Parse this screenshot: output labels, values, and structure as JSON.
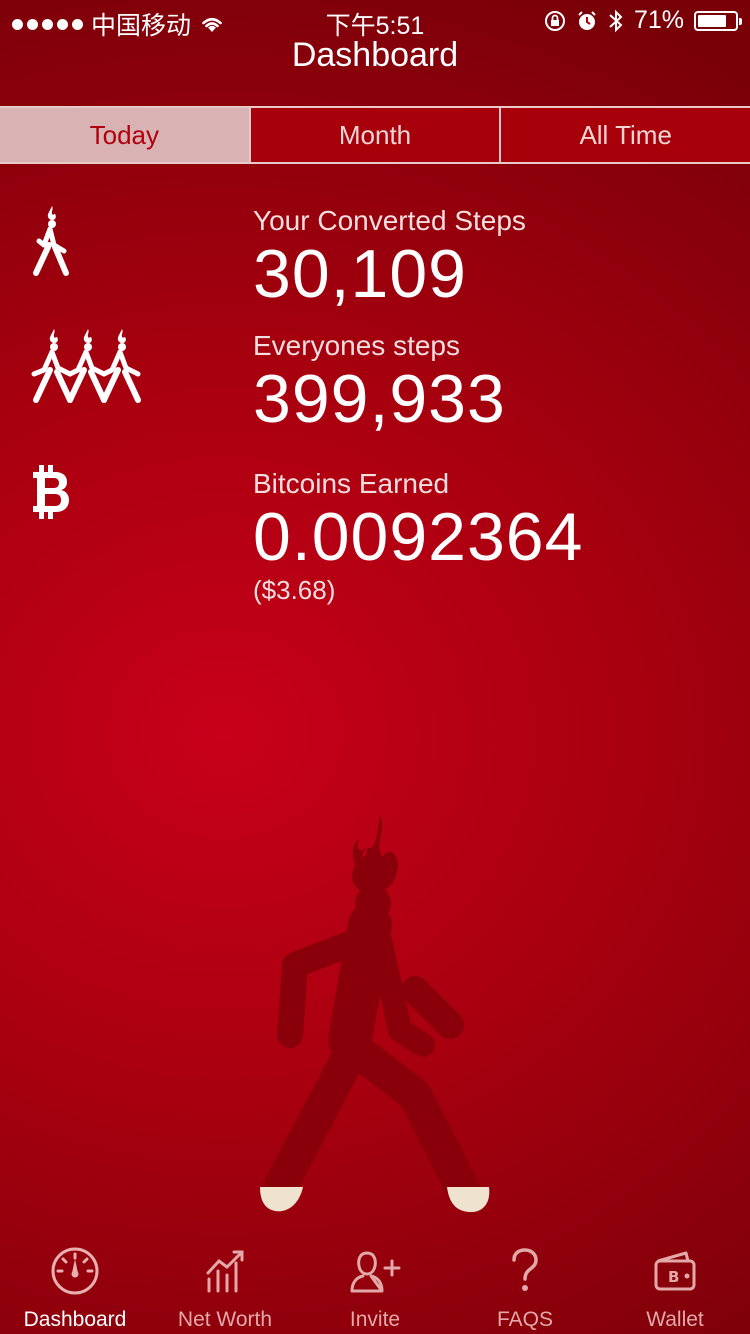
{
  "status_bar": {
    "carrier": "中国移动",
    "time": "下午5:51",
    "battery": "71%"
  },
  "header": {
    "title": "Dashboard"
  },
  "segments": [
    {
      "label": "Today",
      "active": true
    },
    {
      "label": "Month",
      "active": false
    },
    {
      "label": "All Time",
      "active": false
    }
  ],
  "stats": {
    "converted": {
      "label": "Your Converted Steps",
      "value": "30,109",
      "icon": "single-walker-icon"
    },
    "everyone": {
      "label": "Everyones steps",
      "value": "399,933",
      "icon": "group-walkers-icon"
    },
    "bitcoins": {
      "label": "Bitcoins Earned",
      "value": "0.0092364",
      "usd": "($3.68)",
      "icon": "bitcoin-icon"
    }
  },
  "tabbar": [
    {
      "label": "Dashboard",
      "icon": "speedometer-icon",
      "active": true
    },
    {
      "label": "Net Worth",
      "icon": "bar-chart-icon",
      "active": false
    },
    {
      "label": "Invite",
      "icon": "add-person-icon",
      "active": false
    },
    {
      "label": "FAQS",
      "icon": "question-icon",
      "active": false
    },
    {
      "label": "Wallet",
      "icon": "wallet-icon",
      "active": false
    }
  ],
  "colors": {
    "background": "#b8000f",
    "active_tab_bg": "#d9b3b3",
    "tab_bg": "#a8000b",
    "tabbar_inactive": "#e3a8a8",
    "walker": "#8a000a",
    "feet": "#efe3d0"
  }
}
